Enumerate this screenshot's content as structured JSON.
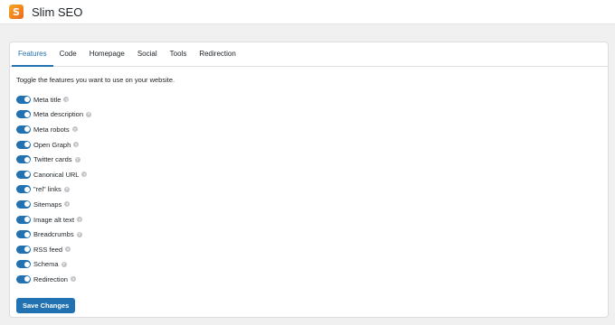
{
  "app": {
    "logo_letter": "S",
    "title": "Slim SEO"
  },
  "tabs": [
    {
      "label": "Features",
      "active": true
    },
    {
      "label": "Code",
      "active": false
    },
    {
      "label": "Homepage",
      "active": false
    },
    {
      "label": "Social",
      "active": false
    },
    {
      "label": "Tools",
      "active": false
    },
    {
      "label": "Redirection",
      "active": false
    }
  ],
  "features_intro": "Toggle the features you want to use on your website.",
  "features": [
    {
      "label": "Meta title",
      "enabled": true
    },
    {
      "label": "Meta description",
      "enabled": true
    },
    {
      "label": "Meta robots",
      "enabled": true
    },
    {
      "label": "Open Graph",
      "enabled": true
    },
    {
      "label": "Twitter cards",
      "enabled": true
    },
    {
      "label": "Canonical URL",
      "enabled": true
    },
    {
      "label": "\"rel\" links",
      "enabled": true
    },
    {
      "label": "Sitemaps",
      "enabled": true
    },
    {
      "label": "Image alt text",
      "enabled": true
    },
    {
      "label": "Breadcrumbs",
      "enabled": true
    },
    {
      "label": "RSS feed",
      "enabled": true
    },
    {
      "label": "Schema",
      "enabled": true
    },
    {
      "label": "Redirection",
      "enabled": true
    }
  ],
  "save_label": "Save Changes",
  "colors": {
    "accent": "#2271b1",
    "logo_orange": "#f08a22",
    "background": "#f0f0f1"
  },
  "icons": {
    "help": "question-circle-icon"
  }
}
